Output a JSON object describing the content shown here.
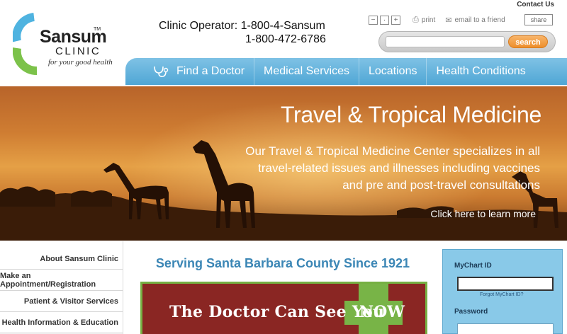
{
  "header": {
    "logo_name": "Sansum",
    "logo_tm": "TM",
    "logo_clinic": "CLINIC",
    "logo_tagline": "for your good health",
    "phone_line1": "Clinic Operator: 1-800-4-Sansum",
    "phone_line2": "1-800-472-6786",
    "contact_us": "Contact Us",
    "text_size_minus": "−",
    "text_size_normal": "·",
    "text_size_plus": "+",
    "print_label": "print",
    "email_label": "email to a friend",
    "share_label": "share",
    "search_placeholder": "",
    "search_button": "search"
  },
  "nav": {
    "items": [
      {
        "label": "Find a Doctor",
        "icon": "stethoscope-icon"
      },
      {
        "label": "Medical Services"
      },
      {
        "label": "Locations"
      },
      {
        "label": "Health Conditions"
      }
    ]
  },
  "hero": {
    "title": "Travel & Tropical Medicine",
    "description": "Our Travel & Tropical Medicine Center specializes in all travel-related issues and illnesses including vaccines and pre and post-travel consultations",
    "link": "Click here to learn more"
  },
  "sidebar": {
    "items": [
      {
        "label": "About Sansum Clinic"
      },
      {
        "label": "Make an Appointment/Registration"
      },
      {
        "label": "Patient & Visitor Services"
      },
      {
        "label": "Health Information & Education"
      }
    ]
  },
  "main": {
    "heading": "Serving Santa Barbara County Since 1921",
    "promo_text": "The Doctor Can See You",
    "promo_now": "NOW"
  },
  "mychart": {
    "id_label": "MyChart ID",
    "forgot_link": "Forgot MyChart ID?",
    "password_label": "Password"
  },
  "colors": {
    "nav_blue": "#5fb0dc",
    "heading_blue": "#3b86b5",
    "search_orange": "#ee8f2c",
    "promo_red": "#8a2623",
    "promo_green": "#78b447",
    "mychart_bg": "#89c9e8"
  }
}
